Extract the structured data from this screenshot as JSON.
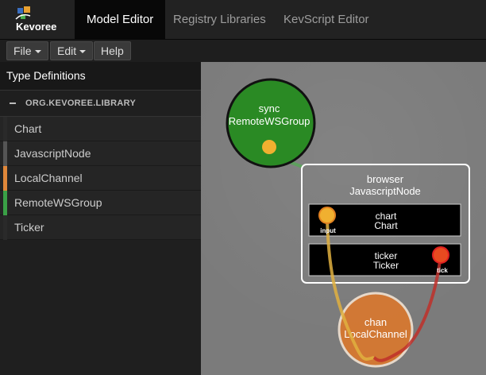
{
  "app": {
    "logo_text": "Kevoree"
  },
  "nav": {
    "tabs": [
      {
        "label": "Model Editor"
      },
      {
        "label": "Registry Libraries"
      },
      {
        "label": "KevScript Editor"
      }
    ]
  },
  "menu": {
    "file": "File",
    "edit": "Edit",
    "help": "Help"
  },
  "sidebar": {
    "title": "Type Definitions",
    "library": "ORG.KEVOREE.LIBRARY",
    "items": [
      {
        "label": "Chart",
        "color": "#2a2a2a"
      },
      {
        "label": "JavascriptNode",
        "color": "#555555"
      },
      {
        "label": "LocalChannel",
        "color": "#e0883a"
      },
      {
        "label": "RemoteWSGroup",
        "color": "#3aa046"
      },
      {
        "label": "Ticker",
        "color": "#2a2a2a"
      }
    ]
  },
  "canvas": {
    "group": {
      "name": "sync",
      "type": "RemoteWSGroup",
      "color": "#2a8a24"
    },
    "node": {
      "name": "browser",
      "type": "JavascriptNode"
    },
    "components": [
      {
        "name": "chart",
        "type": "Chart",
        "port": "input"
      },
      {
        "name": "ticker",
        "type": "Ticker",
        "port": "tick"
      }
    ],
    "channel": {
      "name": "chan",
      "type": "LocalChannel",
      "color": "#d9782f"
    },
    "colors": {
      "input_port": "#f0b030",
      "output_port": "#e84a20",
      "binding_input": "#e0b040",
      "binding_output": "#c0302a",
      "group_link": "#5ea05e"
    }
  }
}
